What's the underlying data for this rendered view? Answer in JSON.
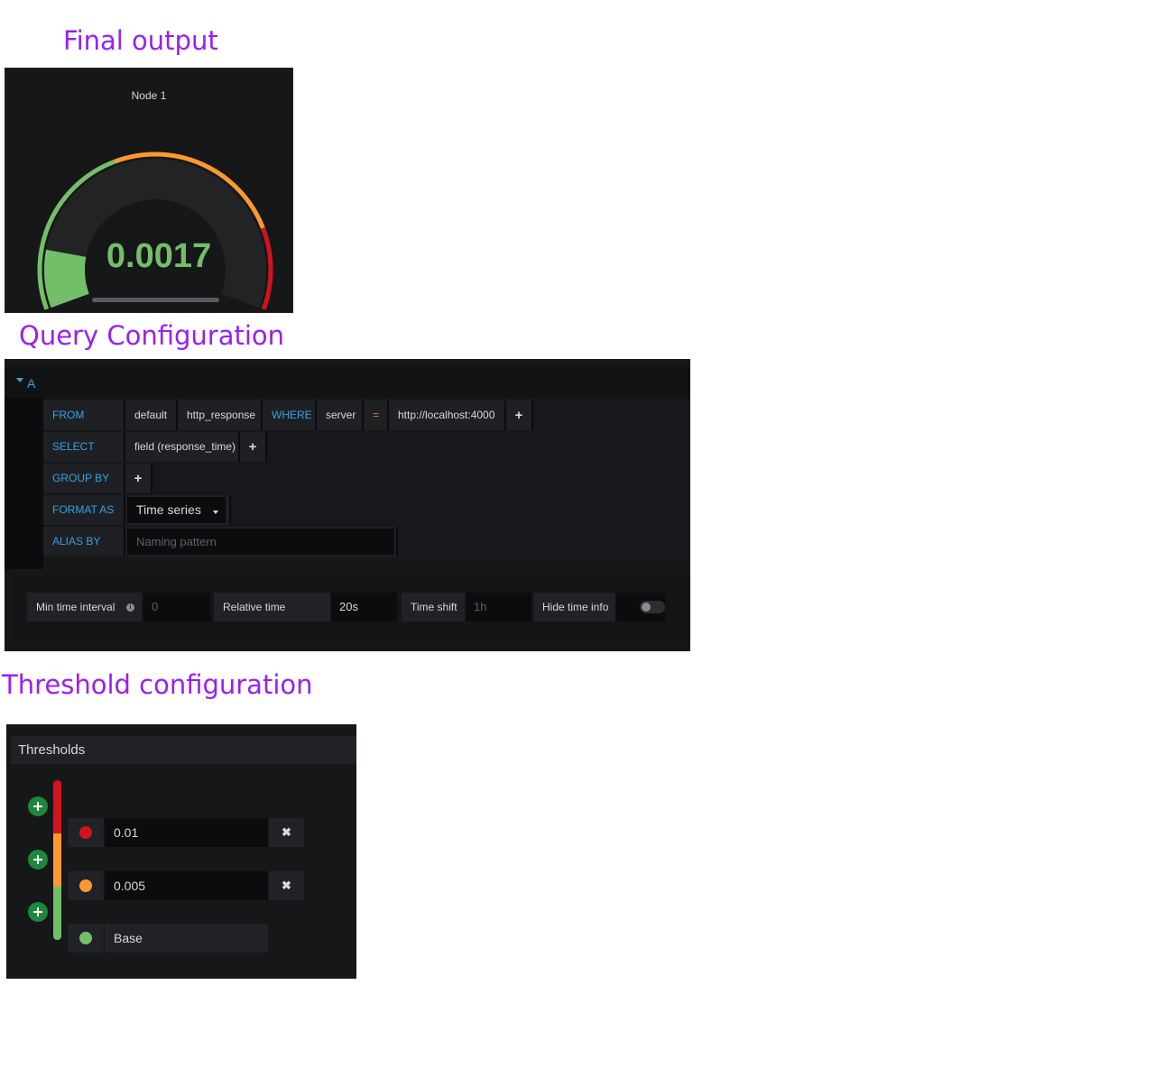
{
  "headings": {
    "final_output": "Final output",
    "query_configuration": "Query Configuration",
    "threshold_configuration": "Threshold configuration"
  },
  "gauge": {
    "title": "Node 1",
    "value_text": "0.0017",
    "value": 0.0017,
    "min": 0,
    "max": 0.0123,
    "value_color": "#73bf69",
    "threshold_colors": {
      "base": "#73bf69",
      "warn": "#ff9830",
      "crit": "#d0141e"
    }
  },
  "query": {
    "ref_id": "A",
    "from_label": "FROM",
    "from_policy": "default",
    "from_measurement": "http_response",
    "where_label": "WHERE",
    "where_key": "server",
    "where_operator": "=",
    "where_value": "http://localhost:4000",
    "select_label": "SELECT",
    "select_field": "field (response_time)",
    "group_by_label": "GROUP BY",
    "format_as_label": "FORMAT AS",
    "format_as_value": "Time series",
    "alias_by_label": "ALIAS BY",
    "alias_placeholder": "Naming pattern",
    "plus_icon": "+"
  },
  "options": {
    "min_interval_label": "Min time interval",
    "min_interval_placeholder": "0",
    "relative_time_label": "Relative time",
    "relative_time_value": "20s",
    "time_shift_label": "Time shift",
    "time_shift_placeholder": "1h",
    "hide_time_info_label": "Hide time info",
    "hide_time_info_enabled": false,
    "info_icon": "i"
  },
  "thresholds": {
    "title": "Thresholds",
    "remove_icon": "✖",
    "items": [
      {
        "value": "0.01",
        "color": "#d0141e"
      },
      {
        "value": "0.005",
        "color": "#ff9830"
      },
      {
        "value": "Base",
        "color": "#73bf69"
      }
    ]
  }
}
